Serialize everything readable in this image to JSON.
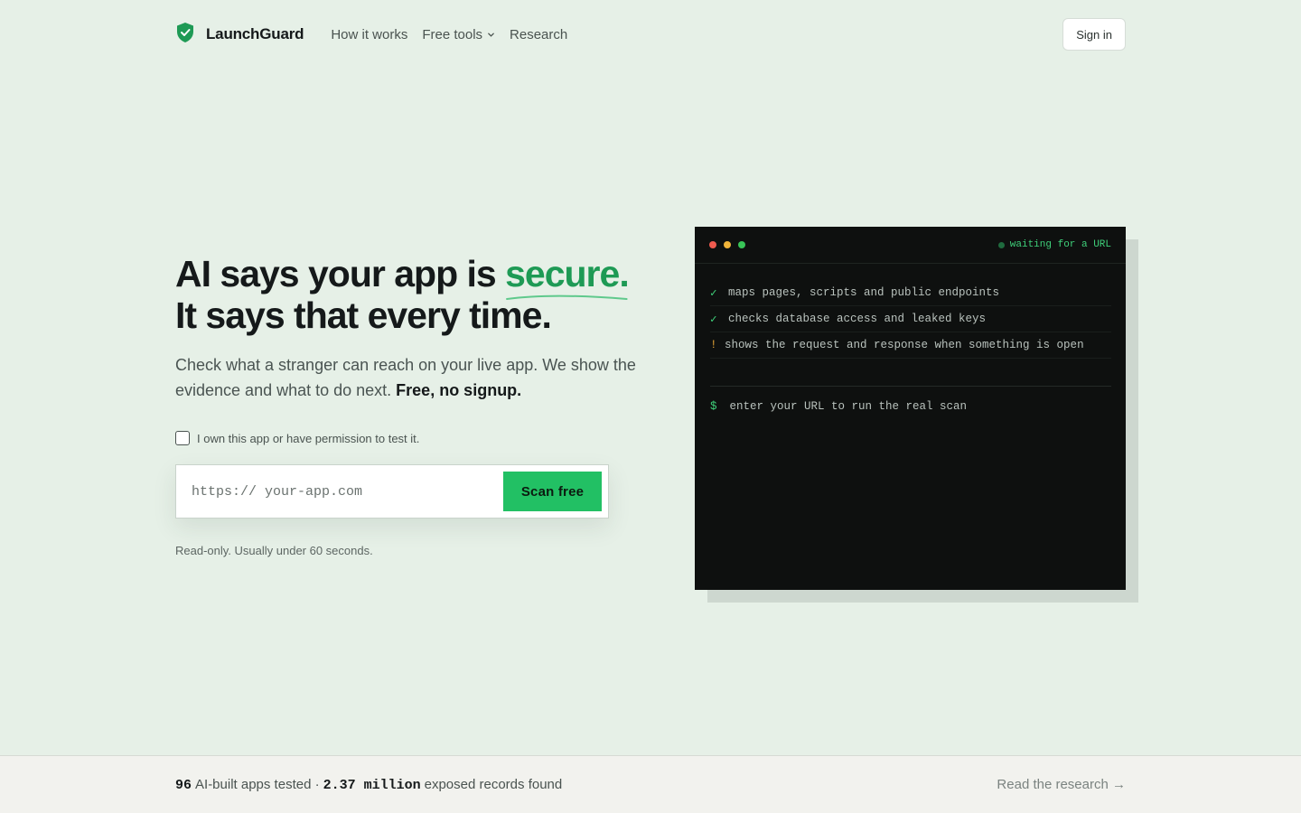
{
  "nav": {
    "brand": "LaunchGuard",
    "links": [
      "How it works",
      "Free tools",
      "Research"
    ],
    "sign_in": "Sign in"
  },
  "hero": {
    "title_pre": "AI says your app is ",
    "title_accent": "secure.",
    "title_line2": "It says that every time.",
    "subtitle": "Check what a stranger can reach on your live app. We show the evidence and what to do next. ",
    "subtitle_strong": "Free, no signup.",
    "permission_label": "I own this app or have permission to test it.",
    "url_placeholder": "https:// your-app.com",
    "scan_button": "Scan free",
    "note": "Read-only. Usually under 60 seconds."
  },
  "terminal": {
    "status": "waiting for a URL",
    "lines": [
      {
        "mark": "✓",
        "text": "maps pages, scripts and public endpoints"
      },
      {
        "mark": "✓",
        "text": "checks database access and leaked keys"
      },
      {
        "mark": "!",
        "text": "shows the request and response when something is open"
      }
    ],
    "prompt_symbol": "$",
    "prompt_text": "enter your URL to run the real scan"
  },
  "footer": {
    "apps_count": "96",
    "apps_label": "AI-built apps tested ·",
    "records_count": "2.37 million",
    "records_label": "exposed records found",
    "research_link": "Read the research →"
  },
  "colors": {
    "accent": "#1e9a55",
    "button": "#22c064",
    "background": "#e6f0e7",
    "terminal_bg": "#0e100f"
  }
}
